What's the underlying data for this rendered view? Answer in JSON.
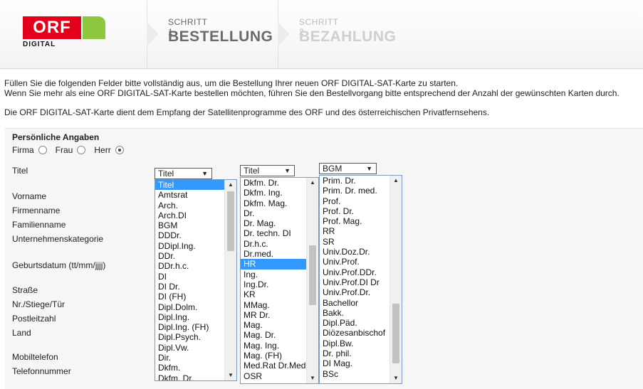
{
  "header": {
    "logo": {
      "brand": "ORF",
      "sub": "DIGITAL",
      "red": "#e2001a",
      "green": "#8dc63f"
    },
    "steps": [
      {
        "small": "SCHRITT 1",
        "big": "BESTELLUNG"
      },
      {
        "small": "SCHRITT 2",
        "big": "BEZAHLUNG"
      }
    ]
  },
  "intro": {
    "line1": "Füllen Sie die folgenden Felder bitte vollständig aus, um die Bestellung Ihrer neuen ORF DIGITAL-SAT-Karte zu starten.",
    "line2": "Wenn Sie mehr als eine ORF DIGITAL-SAT-Karte bestellen möchten, führen Sie den Bestellvorgang bitte entsprechend der Anzahl der gewünschten Karten durch.",
    "line3": "Die ORF DIGITAL-SAT-Karte dient dem Empfang der Satellitenprogramme des ORF und des österreichischen Privatfernsehens."
  },
  "form": {
    "section_title": "Persönliche Angaben",
    "radios": {
      "firma": "Firma",
      "frau": "Frau",
      "herr": "Herr",
      "selected": "Herr"
    },
    "labels": {
      "titel": "Titel",
      "vorname": "Vorname",
      "firmenname": "Firmenname",
      "familienname": "Familienname",
      "unternehmenskategorie": "Unternehmenskategorie",
      "geburtsdatum": "Geburtsdatum (tt/mm/jjjj)",
      "strasse": "Straße",
      "nr": "Nr./Stiege/Tür",
      "plz": "Postleitzahl",
      "land": "Land",
      "mobil": "Mobiltelefon",
      "telefon": "Telefonnummer"
    },
    "dropdowns": [
      {
        "value": "Titel",
        "items": [
          "Titel",
          "Amtsrat",
          "Arch.",
          "Arch.DI",
          "BGM",
          "DDDr.",
          "DDipl.Ing.",
          "DDr.",
          "DDr.h.c.",
          "DI",
          "DI Dr.",
          "DI (FH)",
          "Dipl.Dolm.",
          "Dipl.Ing.",
          "Dipl.Ing. (FH)",
          "Dipl.Psych.",
          "Dipl.Vw.",
          "Dir.",
          "Dkfm.",
          "Dkfm. Dr."
        ],
        "selected": "Titel"
      },
      {
        "value": "Titel",
        "items": [
          "Dkfm. Dr.",
          "Dkfm. Ing.",
          "Dkfm. Mag.",
          "Dr.",
          "Dr. Mag.",
          "Dr. techn. DI",
          "Dr.h.c.",
          "Dr.med.",
          "HR",
          "Ing.",
          "Ing.Dr.",
          "KR",
          "MMag.",
          "MR Dr.",
          "Mag.",
          "Mag. Dr.",
          "Mag. Ing.",
          "Mag. (FH)",
          "Med.Rat Dr.Med",
          "OSR"
        ],
        "selected": "HR"
      },
      {
        "value": "BGM",
        "items": [
          "Prim. Dr.",
          "Prim. Dr. med.",
          "Prof.",
          "Prof. Dr.",
          "Prof. Mag.",
          "RR",
          "SR",
          "Univ.Doz.Dr.",
          "Univ.Prof.",
          "Univ.Prof.DDr.",
          "Univ.Prof.DI Dr",
          "Univ.Prof.Dr.",
          "Bachellor",
          "Bakk.",
          "Dipl.Päd.",
          "Diözesanbischof",
          "Dipl.Bw.",
          "Dr. phil.",
          "DI Mag.",
          "BSc"
        ],
        "selected": ""
      }
    ]
  },
  "colors": {
    "selection": "#3399ff",
    "list_border": "#7a9cc6"
  }
}
